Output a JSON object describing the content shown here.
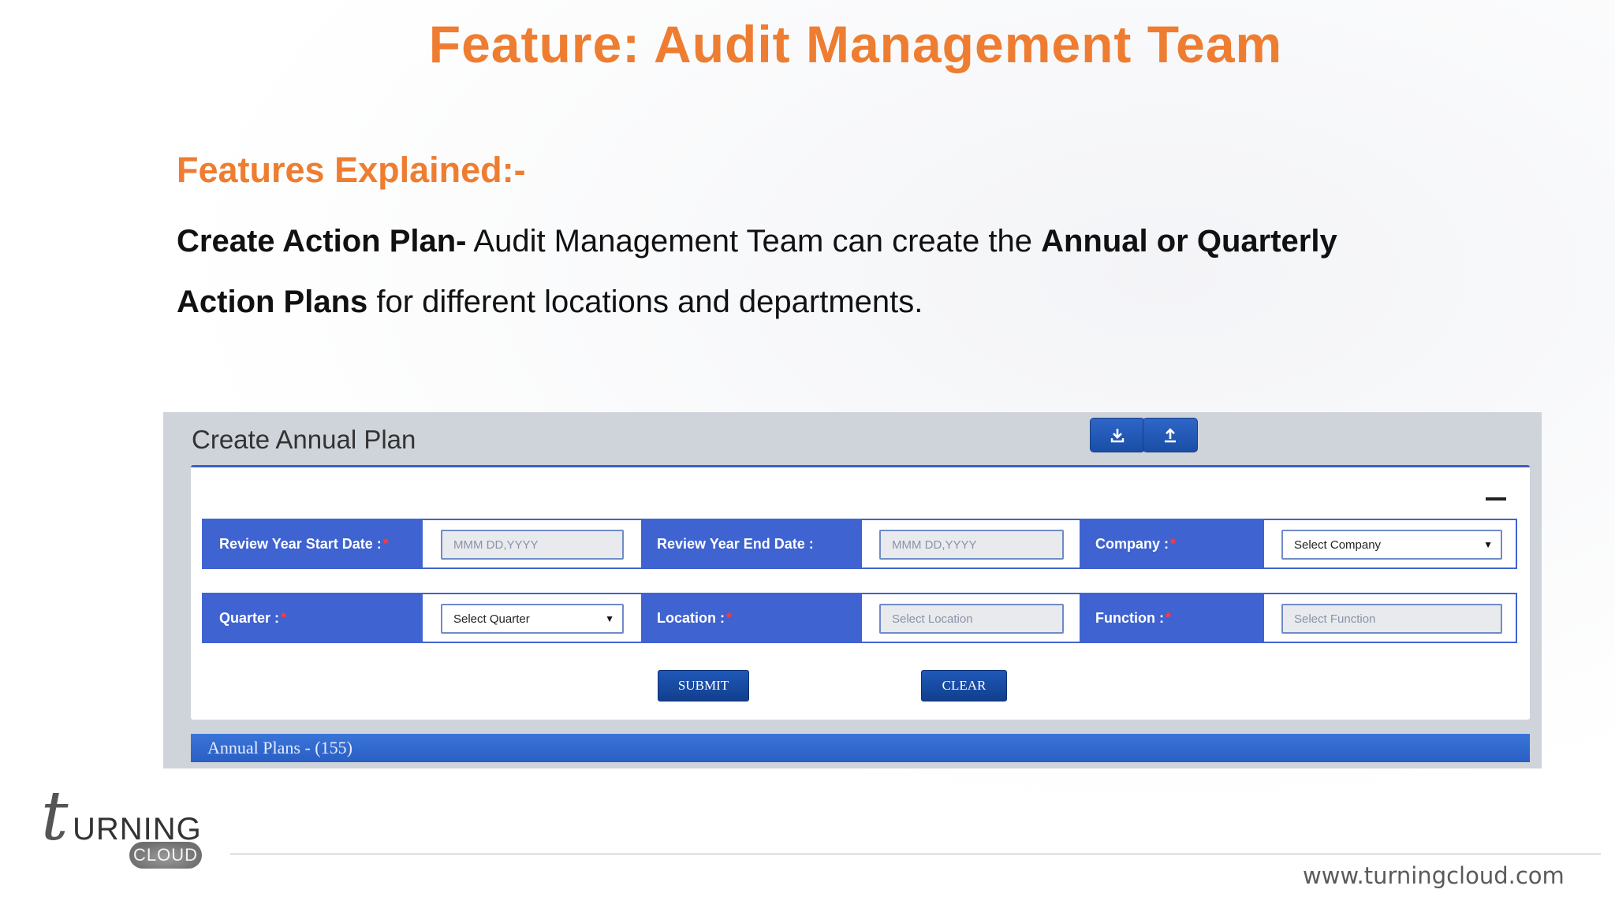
{
  "slide": {
    "title": "Feature: Audit Management Team",
    "features_heading": "Features Explained:-",
    "description": {
      "part1_bold": "Create Action Plan-",
      "part2": " Audit Management Team  can create the ",
      "part3_bold": "Annual or Quarterly Action Plans",
      "part4": " for different locations and departments."
    }
  },
  "panel": {
    "title": "Create Annual Plan",
    "toolbar": {
      "download_icon": "download-icon",
      "upload_icon": "upload-icon"
    },
    "form": {
      "row1": {
        "start_label": "Review Year Start Date :",
        "start_placeholder": "MMM DD,YYYY",
        "end_label": "Review Year End Date :",
        "end_placeholder": "MMM DD,YYYY",
        "company_label": "Company :",
        "company_value": "Select Company"
      },
      "row2": {
        "quarter_label": "Quarter :",
        "quarter_value": "Select Quarter",
        "location_label": "Location :",
        "location_placeholder": "Select Location",
        "function_label": "Function :",
        "function_placeholder": "Select Function"
      },
      "required_mark": "*",
      "submit_label": "SUBMIT",
      "clear_label": "CLEAR"
    },
    "annual_plans_bar": "Annual Plans - (155)"
  },
  "footer": {
    "logo_t": "t",
    "logo_urning": "URNING",
    "logo_cloud": "CLOUD",
    "url": "www.turningcloud.com"
  },
  "colors": {
    "accent_orange": "#ee7d31",
    "form_blue": "#3f63d0",
    "button_navy": "#1a4ea6"
  }
}
